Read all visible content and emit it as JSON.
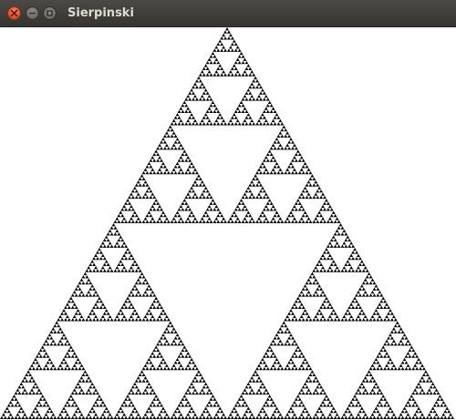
{
  "window": {
    "title": "Sierpinski"
  },
  "icons": {
    "close": "close-icon",
    "minimize": "minimize-icon",
    "maximize": "maximize-icon"
  },
  "colors": {
    "fractal": "#000000",
    "background": "#ffffff",
    "titlebar": "#3d3c38",
    "close_button": "#e8572f"
  }
}
